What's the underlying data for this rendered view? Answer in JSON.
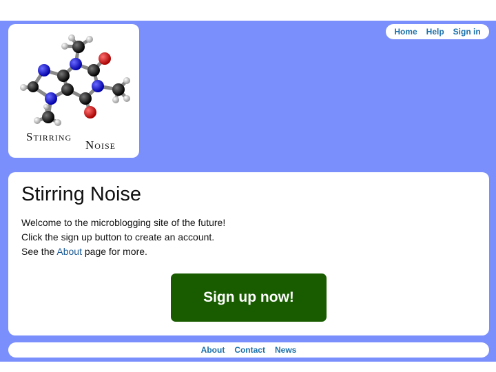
{
  "colors": {
    "page_background": "#7b8ffc",
    "link": "#1a6fa8",
    "signup_button": "#195c00",
    "carbon": "#111111",
    "nitrogen": "#1010d8",
    "oxygen": "#d81010",
    "hydrogen": "#dddddd"
  },
  "logo": {
    "word1": "Stirring",
    "word2": "Noise"
  },
  "top_nav": {
    "items": [
      "Home",
      "Help",
      "Sign in"
    ]
  },
  "main": {
    "title": "Stirring Noise",
    "line1": "Welcome to the microblogging site of the future!",
    "line2": "Click the sign up button to create an account.",
    "line3_prefix": "See the ",
    "line3_link": "About",
    "line3_suffix": " page for more.",
    "signup_label": "Sign up now!"
  },
  "footer": {
    "items": [
      "About",
      "Contact",
      "News"
    ]
  }
}
